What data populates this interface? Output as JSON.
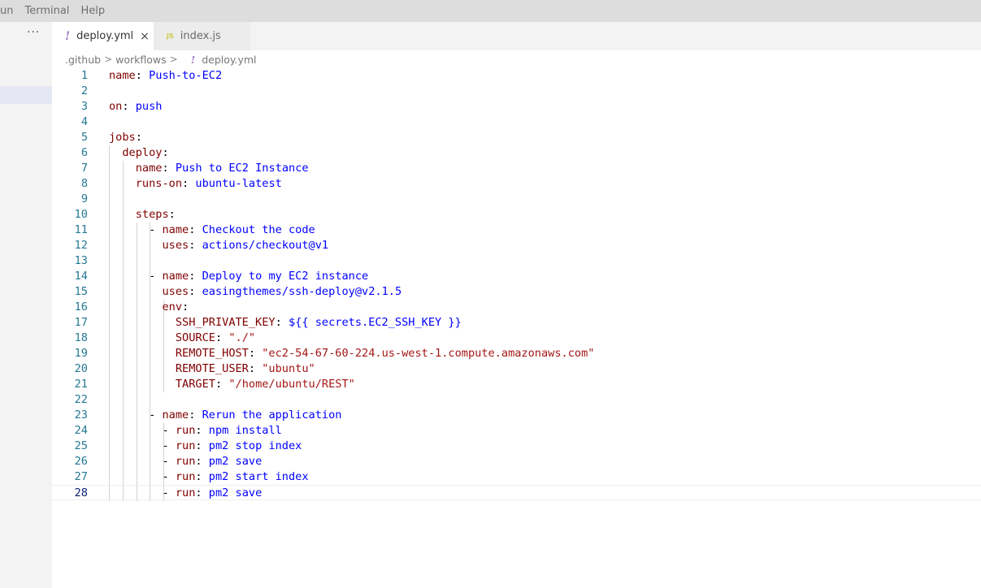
{
  "menu": [
    "un",
    "Terminal",
    "Help"
  ],
  "sidebar": {
    "more_label": "···"
  },
  "tabs": [
    {
      "icon": "!",
      "label": "deploy.yml",
      "close": "×"
    },
    {
      "icon": "JS",
      "label": "index.js"
    }
  ],
  "breadcrumb": {
    "parts": [
      ".github",
      "workflows"
    ],
    "sep": ">",
    "icon": "!",
    "file": "deploy.yml"
  },
  "editor": {
    "current_line": 28,
    "lines": [
      {
        "n": "1",
        "indent": "",
        "key": "name",
        "value": "Push-to-EC2",
        "vtype": "v"
      },
      {
        "n": "2",
        "indent": "",
        "key": "",
        "value": "",
        "vtype": "v"
      },
      {
        "n": "3",
        "indent": "",
        "key": "on",
        "value": "push",
        "vtype": "v"
      },
      {
        "n": "4",
        "indent": "",
        "key": "",
        "value": "",
        "vtype": "v"
      },
      {
        "n": "5",
        "indent": "",
        "key": "jobs",
        "value": "",
        "vtype": "v"
      },
      {
        "n": "6",
        "indent": "  ",
        "key": "deploy",
        "value": "",
        "vtype": "v"
      },
      {
        "n": "7",
        "indent": "    ",
        "key": "name",
        "value": "Push to EC2 Instance",
        "vtype": "v"
      },
      {
        "n": "8",
        "indent": "    ",
        "key": "runs-on",
        "value": "ubuntu-latest",
        "vtype": "v"
      },
      {
        "n": "9",
        "indent": "",
        "key": "",
        "value": "",
        "vtype": "v"
      },
      {
        "n": "10",
        "indent": "    ",
        "key": "steps",
        "value": "",
        "vtype": "v"
      },
      {
        "n": "11",
        "indent": "      - ",
        "key": "name",
        "value": "Checkout the code",
        "vtype": "v"
      },
      {
        "n": "12",
        "indent": "        ",
        "key": "uses",
        "value": "actions/checkout@v1",
        "vtype": "v"
      },
      {
        "n": "13",
        "indent": "",
        "key": "",
        "value": "",
        "vtype": "v"
      },
      {
        "n": "14",
        "indent": "      - ",
        "key": "name",
        "value": "Deploy to my EC2 instance",
        "vtype": "v"
      },
      {
        "n": "15",
        "indent": "        ",
        "key": "uses",
        "value": "easingthemes/ssh-deploy@v2.1.5",
        "vtype": "v"
      },
      {
        "n": "16",
        "indent": "        ",
        "key": "env",
        "value": "",
        "vtype": "v"
      },
      {
        "n": "17",
        "indent": "          ",
        "key": "SSH_PRIVATE_KEY",
        "value": "${{ secrets.EC2_SSH_KEY }}",
        "vtype": "v"
      },
      {
        "n": "18",
        "indent": "          ",
        "key": "SOURCE",
        "value": "\"./\"",
        "vtype": "s"
      },
      {
        "n": "19",
        "indent": "          ",
        "key": "REMOTE_HOST",
        "value": "\"ec2-54-67-60-224.us-west-1.compute.amazonaws.com\"",
        "vtype": "s"
      },
      {
        "n": "20",
        "indent": "          ",
        "key": "REMOTE_USER",
        "value": "\"ubuntu\"",
        "vtype": "s"
      },
      {
        "n": "21",
        "indent": "          ",
        "key": "TARGET",
        "value": "\"/home/ubuntu/REST\"",
        "vtype": "s"
      },
      {
        "n": "22",
        "indent": "",
        "key": "",
        "value": "",
        "vtype": "v"
      },
      {
        "n": "23",
        "indent": "      - ",
        "key": "name",
        "value": "Rerun the application",
        "vtype": "v"
      },
      {
        "n": "24",
        "indent": "        - ",
        "key": "run",
        "value": "npm install",
        "vtype": "v"
      },
      {
        "n": "25",
        "indent": "        - ",
        "key": "run",
        "value": "pm2 stop index",
        "vtype": "v"
      },
      {
        "n": "26",
        "indent": "        - ",
        "key": "run",
        "value": "pm2 save",
        "vtype": "v"
      },
      {
        "n": "27",
        "indent": "        - ",
        "key": "run",
        "value": "pm2 start index",
        "vtype": "v"
      },
      {
        "n": "28",
        "indent": "        - ",
        "key": "run",
        "value": "pm2 save",
        "vtype": "v"
      }
    ]
  },
  "colors": {
    "key": "#800000",
    "value": "#0000ff",
    "string": "#a31515",
    "line_number": "#237893"
  }
}
